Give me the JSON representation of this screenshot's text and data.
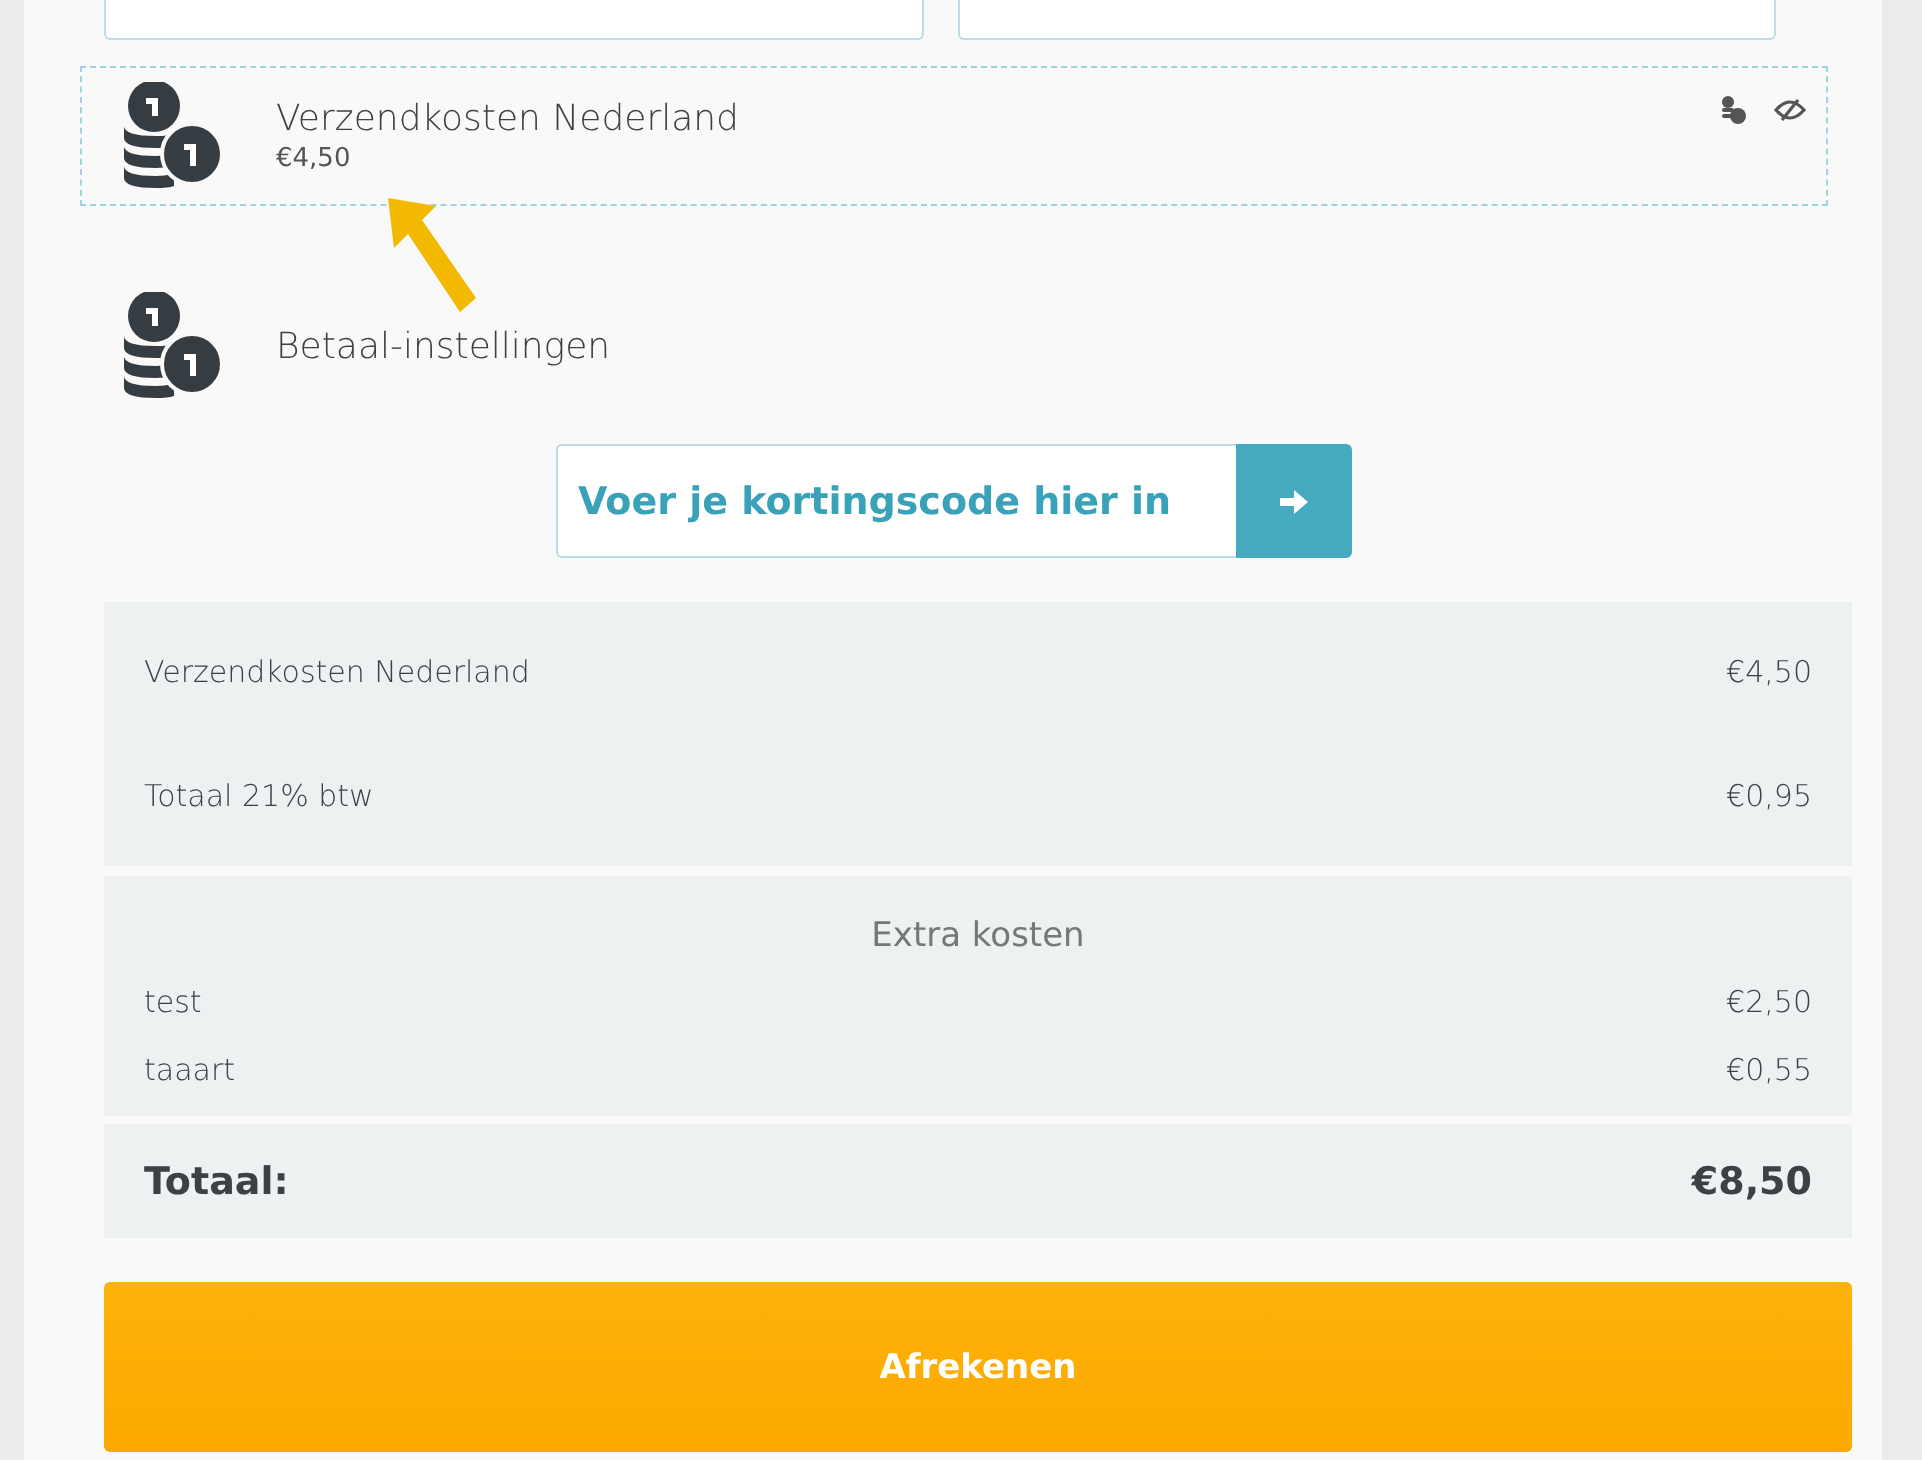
{
  "shipping_option": {
    "title": "Verzendkosten Nederland",
    "price": "€4,50"
  },
  "payment_settings": {
    "title": "Betaal-instellingen"
  },
  "discount": {
    "placeholder": "Voer je kortingscode hier in"
  },
  "summary": {
    "rows": [
      {
        "label": "Verzendkosten Nederland",
        "value": "€4,50"
      },
      {
        "label": "Totaal 21% btw",
        "value": "€0,95"
      }
    ],
    "extra": {
      "title": "Extra kosten",
      "items": [
        {
          "label": "test",
          "value": "€2,50"
        },
        {
          "label": "taaart",
          "value": "€0,55"
        }
      ]
    },
    "total": {
      "label": "Totaal:",
      "value": "€8,50"
    }
  },
  "checkout_button": "Afrekenen"
}
